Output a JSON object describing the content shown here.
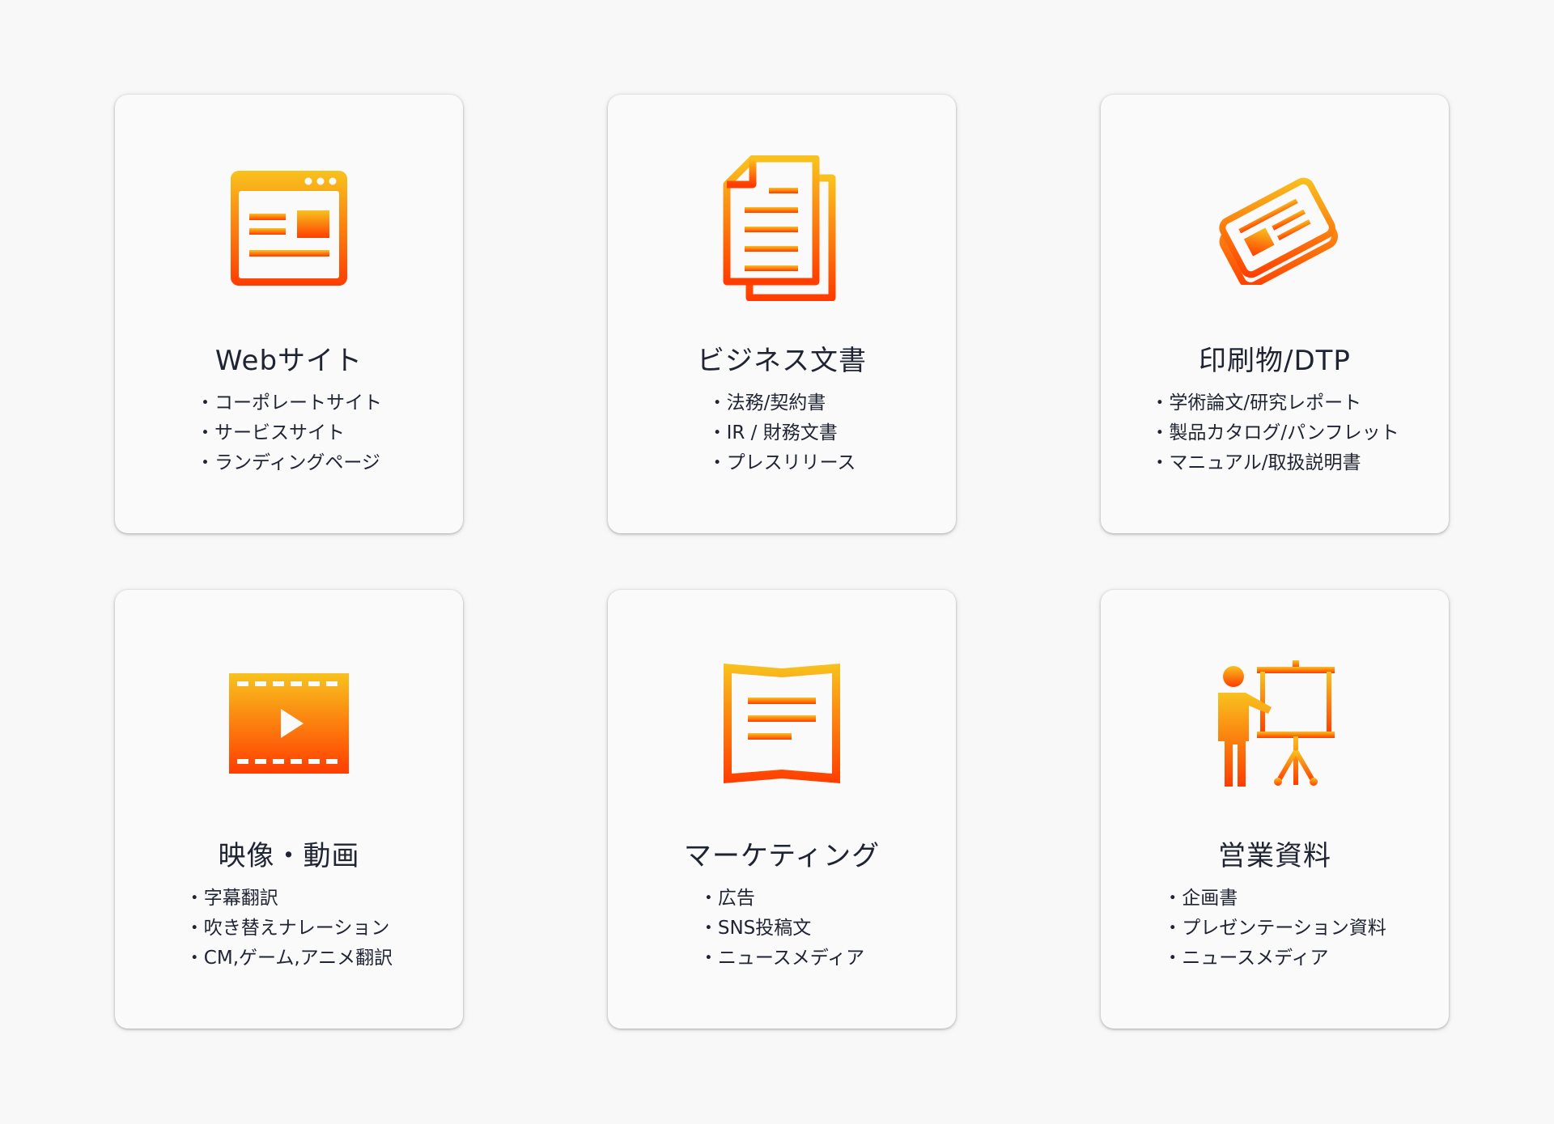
{
  "colors": {
    "background": "#f8f8f8",
    "card": "#fafafa",
    "text": "#1f2433",
    "gradient_top": "#f8c21e",
    "gradient_bottom": "#ff3d00"
  },
  "cards": [
    {
      "icon": "web-browser-icon",
      "title": "Webサイト",
      "items": [
        "コーポレートサイト",
        "サービスサイト",
        "ランディングページ"
      ]
    },
    {
      "icon": "documents-icon",
      "title": "ビジネス文書",
      "items": [
        "法務/契約書",
        "IR / 財務文書",
        "プレスリリース"
      ]
    },
    {
      "icon": "newspaper-icon",
      "title": "印刷物/DTP",
      "items": [
        "学術論文/研究レポート",
        "製品カタログ/パンフレット",
        "マニュアル/取扱説明書"
      ]
    },
    {
      "icon": "video-film-icon",
      "title": "映像・動画",
      "items": [
        "字幕翻訳",
        "吹き替えナレーション",
        "CM,ゲーム,アニメ翻訳"
      ]
    },
    {
      "icon": "open-book-icon",
      "title": "マーケティング",
      "items": [
        "広告",
        "SNS投稿文",
        "ニュースメディア"
      ]
    },
    {
      "icon": "presentation-icon",
      "title": "営業資料",
      "items": [
        "企画書",
        "プレゼンテーション資料",
        "ニュースメディア"
      ]
    }
  ]
}
